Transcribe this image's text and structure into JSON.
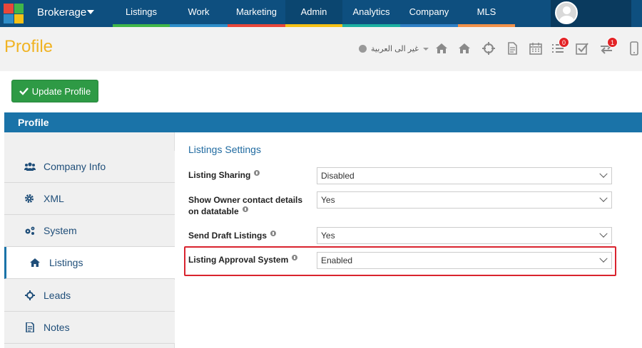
{
  "topbar": {
    "brand": "Brokerage",
    "tabs": [
      {
        "label": "Listings",
        "color": "#41b649"
      },
      {
        "label": "Work",
        "color": "#2e8ec9"
      },
      {
        "label": "Marketing",
        "color": "#e8473a"
      },
      {
        "label": "Admin",
        "color": "#f5c116"
      },
      {
        "label": "Analytics",
        "color": "#1cb0a1"
      },
      {
        "label": "Company",
        "color": "#2f7fc4"
      },
      {
        "label": "MLS",
        "color": "#f0914a"
      }
    ],
    "active_tab": "Admin",
    "icons": [
      "brand-logo-icon",
      "avatar-icon"
    ]
  },
  "header": {
    "title": "Profile",
    "language": "غير الى العربية",
    "icons": [
      "globe-icon",
      "home-icon",
      "home-alt-icon",
      "crosshair-icon",
      "document-icon",
      "calendar-icon",
      "list-icon",
      "checkbox-icon",
      "transfer-icon",
      "mobile-icon"
    ],
    "badges": {
      "list": "0",
      "transfer": "1"
    }
  },
  "actions": {
    "update_label": "Update Profile"
  },
  "section": {
    "title": "Profile"
  },
  "sidebar": {
    "items": [
      {
        "label": "Company Info",
        "icon": "users-icon"
      },
      {
        "label": "XML",
        "icon": "gear-icon"
      },
      {
        "label": "System",
        "icon": "gears-icon"
      },
      {
        "label": "Listings",
        "icon": "home-icon"
      },
      {
        "label": "Leads",
        "icon": "crosshair-icon"
      },
      {
        "label": "Notes",
        "icon": "notes-icon"
      }
    ],
    "active_item": "Listings"
  },
  "settings": {
    "title": "Listings Settings",
    "fields": [
      {
        "label": "Listing Sharing",
        "value": "Disabled"
      },
      {
        "label_line1": "Show Owner contact details",
        "label_line2": "on datatable",
        "value": "Yes"
      },
      {
        "label": "Send Draft Listings",
        "value": "Yes"
      },
      {
        "label": "Listing Approval System",
        "value": "Enabled"
      }
    ]
  },
  "colors": {
    "topbar": "#0e4f7f",
    "accent": "#1a73a8",
    "title": "#f0b323",
    "update_button": "#2e9a45",
    "highlight": "#d9232e"
  }
}
